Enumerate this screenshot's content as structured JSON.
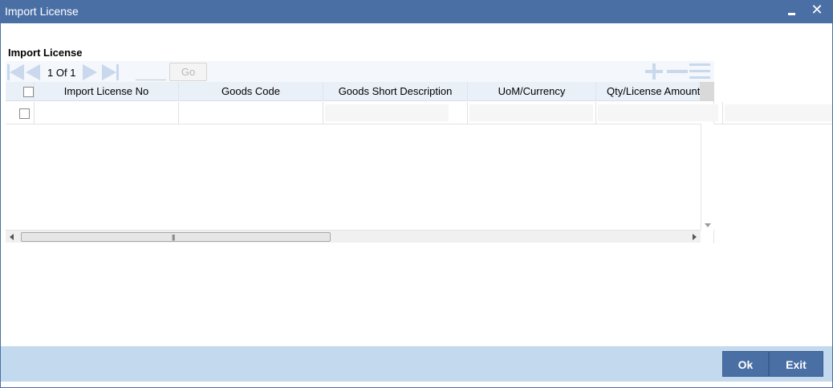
{
  "window": {
    "title": "Import License",
    "close_glyph": "✕"
  },
  "section": {
    "title": "Import License"
  },
  "pagination": {
    "current": "1",
    "of_label": "Of",
    "total": "1",
    "page_input_value": "",
    "go_label": "Go"
  },
  "table": {
    "columns": [
      "Import License No",
      "Goods Code",
      "Goods Short Description",
      "UoM/Currency",
      "Qty/License Amount"
    ],
    "rows": [
      {
        "import_license_no": "",
        "goods_code": "",
        "goods_short_description": "",
        "uom_currency": "",
        "qty_license_amount": ""
      }
    ]
  },
  "footer": {
    "ok_label": "Ok",
    "exit_label": "Exit"
  },
  "colors": {
    "title_bar": "#4a6fa5",
    "footer_bar": "#c3d9ee",
    "button": "#4a6fa5",
    "nav_icon": "#c9d8ec",
    "header_row": "#eaf0f8"
  },
  "icons": {
    "first": "first-page-icon",
    "prev": "prev-page-icon",
    "next": "next-page-icon",
    "last": "last-page-icon",
    "add": "add-row-icon",
    "delete": "delete-row-icon",
    "single_view": "single-record-view-icon",
    "minimize": "minimize-icon",
    "close": "close-icon"
  }
}
